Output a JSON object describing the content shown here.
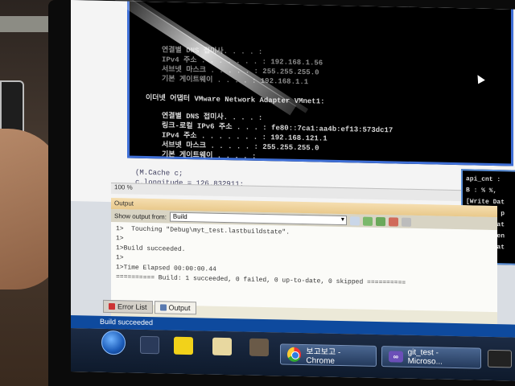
{
  "cmd_window": {
    "lines": [
      "연결별 DNS 접미사. . . . :",
      "IPv4 주소 . . . . . . . : 192.168.1.56",
      "서브넷 마스크 . . . . . : 255.255.255.0",
      "기본 게이트웨이 . . . . : 192.168.1.1",
      "이더넷 어댑터 VMware Network Adapter VMnet1:",
      "연결별 DNS 접미사. . . . :",
      "링크-로컬 IPv6 주소 . . . : fe80::7ca1:aa4b:ef13:573dc17",
      "IPv4 주소 . . . . . . . : 192.168.121.1",
      "서브넷 마스크 . . . . . : 255.255.255.0",
      "기본 게이트웨이 . . . . :"
    ]
  },
  "right_console": {
    "lines": [
      "api_cnt :",
      "B : % %,",
      "[Write Dat",
      "Send all p",
      "ReleaseDat",
      "CloseClien",
      "ReleaseDat"
    ]
  },
  "editor": {
    "lines": [
      "(M.Cache c;",
      "c.longitude = 126.832911;"
    ],
    "zoom": "100 %"
  },
  "output_pane": {
    "title": "Output",
    "show_output_from_label": "Show output from:",
    "source_selected": "Build",
    "lines": [
      "1>  Touching \"Debug\\myt_test.lastbuildstate\".",
      "1>",
      "1>Build succeeded.",
      "1>",
      "1>Time Elapsed 00:00:00.44",
      "========== Build: 1 succeeded, 0 failed, 0 up-to-date, 0 skipped =========="
    ]
  },
  "tabs": [
    {
      "label": "Error List"
    },
    {
      "label": "Output"
    }
  ],
  "status": {
    "text": "Build succeeded"
  },
  "taskbar": {
    "items": [
      {
        "label": "보고보고 - Chrome"
      },
      {
        "label": "git_test - Microso..."
      }
    ]
  },
  "colors": {
    "cmd_border": "#3f6fd6",
    "status_bar": "#0e4a9e",
    "output_title": "#e9c98b"
  }
}
